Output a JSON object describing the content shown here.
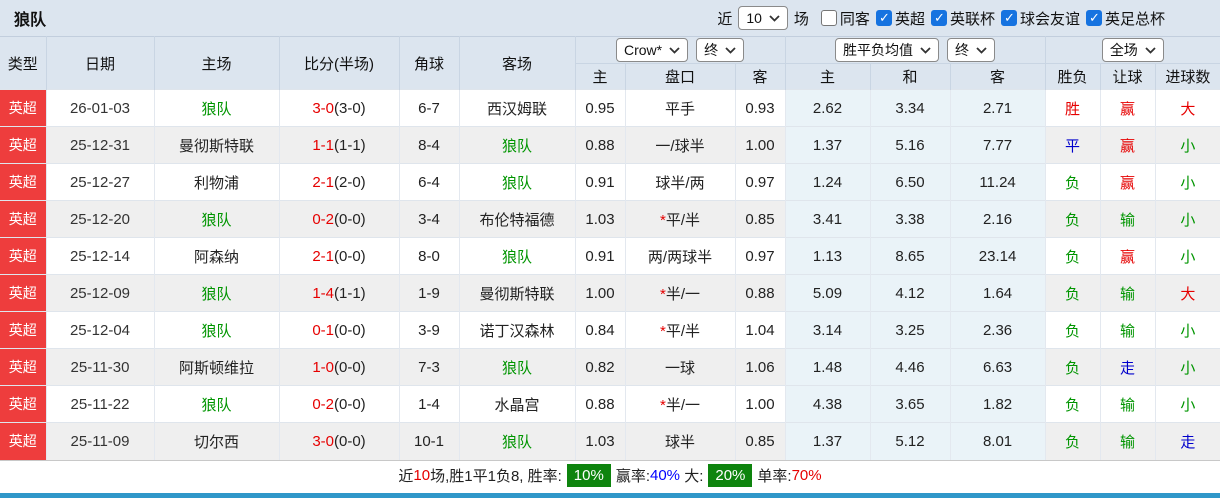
{
  "topbar": {
    "title": "狼队",
    "recent_label": "近",
    "recent_value": "10",
    "matches_label": "场",
    "filters": [
      {
        "label": "同客",
        "checked": false
      },
      {
        "label": "英超",
        "checked": true
      },
      {
        "label": "英联杯",
        "checked": true
      },
      {
        "label": "球会友谊",
        "checked": true
      },
      {
        "label": "英足总杯",
        "checked": true
      }
    ]
  },
  "header": {
    "static_cols": [
      "类型",
      "日期",
      "主场",
      "比分(半场)",
      "角球",
      "客场"
    ],
    "crow_select": "Crow*",
    "crow_period_select": "终",
    "avg_select": "胜平负均值",
    "avg_period_select": "终",
    "scope_select": "全场",
    "sub_cols": [
      "主",
      "盘口",
      "客",
      "主",
      "和",
      "客",
      "胜负",
      "让球",
      "进球数"
    ]
  },
  "rows": [
    {
      "league": "英超",
      "date": "26-01-03",
      "home": "狼队",
      "home_color": "green",
      "score": "3-0",
      "half": "(3-0)",
      "corner": "6-7",
      "away": "西汉姆联",
      "away_color": "black",
      "odds_home": "0.95",
      "handicap_star": "",
      "handicap": "平手",
      "odds_away": "0.93",
      "avg_home": "2.62",
      "avg_draw": "3.34",
      "avg_away": "2.71",
      "result": {
        "text": "胜",
        "color": "red"
      },
      "let_ball": {
        "text": "赢",
        "color": "red"
      },
      "goals": {
        "text": "大",
        "color": "red"
      }
    },
    {
      "league": "英超",
      "date": "25-12-31",
      "home": "曼彻斯特联",
      "home_color": "black",
      "score": "1-1",
      "half": "(1-1)",
      "corner": "8-4",
      "away": "狼队",
      "away_color": "green",
      "odds_home": "0.88",
      "handicap_star": "",
      "handicap": "一/球半",
      "odds_away": "1.00",
      "avg_home": "1.37",
      "avg_draw": "5.16",
      "avg_away": "7.77",
      "result": {
        "text": "平",
        "color": "blue"
      },
      "let_ball": {
        "text": "赢",
        "color": "red"
      },
      "goals": {
        "text": "小",
        "color": "green"
      }
    },
    {
      "league": "英超",
      "date": "25-12-27",
      "home": "利物浦",
      "home_color": "black",
      "score": "2-1",
      "half": "(2-0)",
      "corner": "6-4",
      "away": "狼队",
      "away_color": "green",
      "odds_home": "0.91",
      "handicap_star": "",
      "handicap": "球半/两",
      "odds_away": "0.97",
      "avg_home": "1.24",
      "avg_draw": "6.50",
      "avg_away": "11.24",
      "result": {
        "text": "负",
        "color": "green"
      },
      "let_ball": {
        "text": "赢",
        "color": "red"
      },
      "goals": {
        "text": "小",
        "color": "green"
      }
    },
    {
      "league": "英超",
      "date": "25-12-20",
      "home": "狼队",
      "home_color": "green",
      "score": "0-2",
      "half": "(0-0)",
      "corner": "3-4",
      "away": "布伦特福德",
      "away_color": "black",
      "odds_home": "1.03",
      "handicap_star": "*",
      "handicap": "平/半",
      "odds_away": "0.85",
      "avg_home": "3.41",
      "avg_draw": "3.38",
      "avg_away": "2.16",
      "result": {
        "text": "负",
        "color": "green"
      },
      "let_ball": {
        "text": "输",
        "color": "green"
      },
      "goals": {
        "text": "小",
        "color": "green"
      }
    },
    {
      "league": "英超",
      "date": "25-12-14",
      "home": "阿森纳",
      "home_color": "black",
      "score": "2-1",
      "half": "(0-0)",
      "corner": "8-0",
      "away": "狼队",
      "away_color": "green",
      "odds_home": "0.91",
      "handicap_star": "",
      "handicap": "两/两球半",
      "odds_away": "0.97",
      "avg_home": "1.13",
      "avg_draw": "8.65",
      "avg_away": "23.14",
      "result": {
        "text": "负",
        "color": "green"
      },
      "let_ball": {
        "text": "赢",
        "color": "red"
      },
      "goals": {
        "text": "小",
        "color": "green"
      }
    },
    {
      "league": "英超",
      "date": "25-12-09",
      "home": "狼队",
      "home_color": "green",
      "score": "1-4",
      "half": "(1-1)",
      "corner": "1-9",
      "away": "曼彻斯特联",
      "away_color": "black",
      "odds_home": "1.00",
      "handicap_star": "*",
      "handicap": "半/一",
      "odds_away": "0.88",
      "avg_home": "5.09",
      "avg_draw": "4.12",
      "avg_away": "1.64",
      "result": {
        "text": "负",
        "color": "green"
      },
      "let_ball": {
        "text": "输",
        "color": "green"
      },
      "goals": {
        "text": "大",
        "color": "red"
      }
    },
    {
      "league": "英超",
      "date": "25-12-04",
      "home": "狼队",
      "home_color": "green",
      "score": "0-1",
      "half": "(0-0)",
      "corner": "3-9",
      "away": "诺丁汉森林",
      "away_color": "black",
      "odds_home": "0.84",
      "handicap_star": "*",
      "handicap": "平/半",
      "odds_away": "1.04",
      "avg_home": "3.14",
      "avg_draw": "3.25",
      "avg_away": "2.36",
      "result": {
        "text": "负",
        "color": "green"
      },
      "let_ball": {
        "text": "输",
        "color": "green"
      },
      "goals": {
        "text": "小",
        "color": "green"
      }
    },
    {
      "league": "英超",
      "date": "25-11-30",
      "home": "阿斯顿维拉",
      "home_color": "black",
      "score": "1-0",
      "half": "(0-0)",
      "corner": "7-3",
      "away": "狼队",
      "away_color": "green",
      "odds_home": "0.82",
      "handicap_star": "",
      "handicap": "一球",
      "odds_away": "1.06",
      "avg_home": "1.48",
      "avg_draw": "4.46",
      "avg_away": "6.63",
      "result": {
        "text": "负",
        "color": "green"
      },
      "let_ball": {
        "text": "走",
        "color": "blue"
      },
      "goals": {
        "text": "小",
        "color": "green"
      }
    },
    {
      "league": "英超",
      "date": "25-11-22",
      "home": "狼队",
      "home_color": "green",
      "score": "0-2",
      "half": "(0-0)",
      "corner": "1-4",
      "away": "水晶宫",
      "away_color": "black",
      "odds_home": "0.88",
      "handicap_star": "*",
      "handicap": "半/一",
      "odds_away": "1.00",
      "avg_home": "4.38",
      "avg_draw": "3.65",
      "avg_away": "1.82",
      "result": {
        "text": "负",
        "color": "green"
      },
      "let_ball": {
        "text": "输",
        "color": "green"
      },
      "goals": {
        "text": "小",
        "color": "green"
      }
    },
    {
      "league": "英超",
      "date": "25-11-09",
      "home": "切尔西",
      "home_color": "black",
      "score": "3-0",
      "half": "(0-0)",
      "corner": "10-1",
      "away": "狼队",
      "away_color": "green",
      "odds_home": "1.03",
      "handicap_star": "",
      "handicap": "球半",
      "odds_away": "0.85",
      "avg_home": "1.37",
      "avg_draw": "5.12",
      "avg_away": "8.01",
      "result": {
        "text": "负",
        "color": "green"
      },
      "let_ball": {
        "text": "输",
        "color": "green"
      },
      "goals": {
        "text": "走",
        "color": "blue"
      }
    }
  ],
  "footer": {
    "segments": [
      {
        "text": "近",
        "style": "black"
      },
      {
        "text": "10",
        "style": "red"
      },
      {
        "text": "场,胜1平1负8, 胜率:",
        "style": "black"
      },
      {
        "text": "10%",
        "style": "badge"
      },
      {
        "text": "赢率:",
        "style": "black"
      },
      {
        "text": "40%",
        "style": "blue-bright"
      },
      {
        "text": " 大:",
        "style": "black"
      },
      {
        "text": "20%",
        "style": "badge"
      },
      {
        "text": "单率:",
        "style": "black"
      },
      {
        "text": "70%",
        "style": "red"
      }
    ]
  },
  "colors": {
    "league_badge": "#ee3d3d",
    "win_red": "#e60000",
    "lose_green": "#009500",
    "draw_blue": "#0000cc",
    "badge_green": "#0e840e",
    "header_bg": "#dce5ef",
    "mean_col_bg": "#eaf3f8",
    "bottom_bar": "#2f97c9",
    "checkbox_blue": "#1673e0"
  }
}
